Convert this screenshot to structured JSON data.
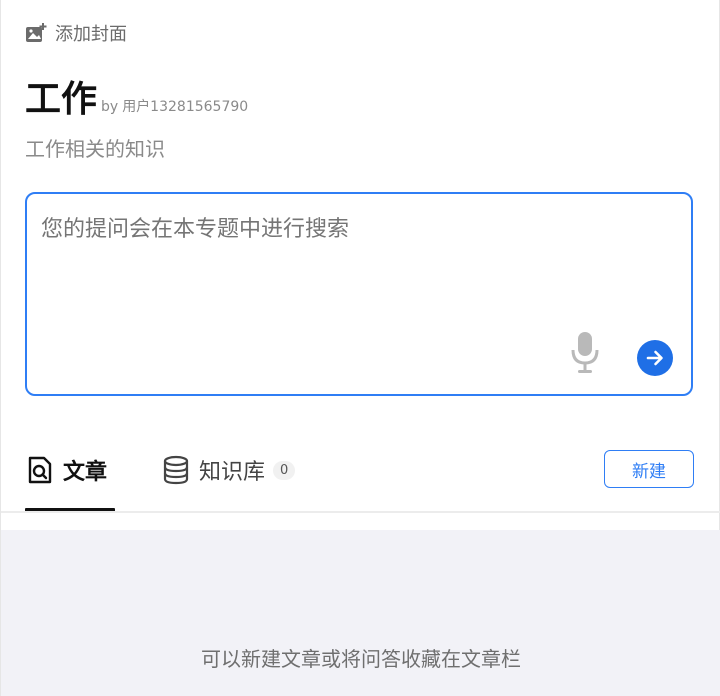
{
  "header": {
    "add_cover_label": "添加封面"
  },
  "topic": {
    "title": "工作",
    "author_prefix": "by",
    "author_name": "用户13281565790",
    "description": "工作相关的知识"
  },
  "query": {
    "placeholder": "您的提问会在本专题中进行搜索",
    "value": ""
  },
  "tabs": [
    {
      "label": "文章",
      "active": true
    },
    {
      "label": "知识库",
      "count": "0",
      "active": false
    }
  ],
  "actions": {
    "new_label": "新建"
  },
  "content": {
    "empty_hint": "可以新建文章或将问答收藏在文章栏"
  },
  "colors": {
    "accent": "#2f7ef5",
    "send_button": "#1f6fe6",
    "content_bg": "#f2f2f7"
  }
}
